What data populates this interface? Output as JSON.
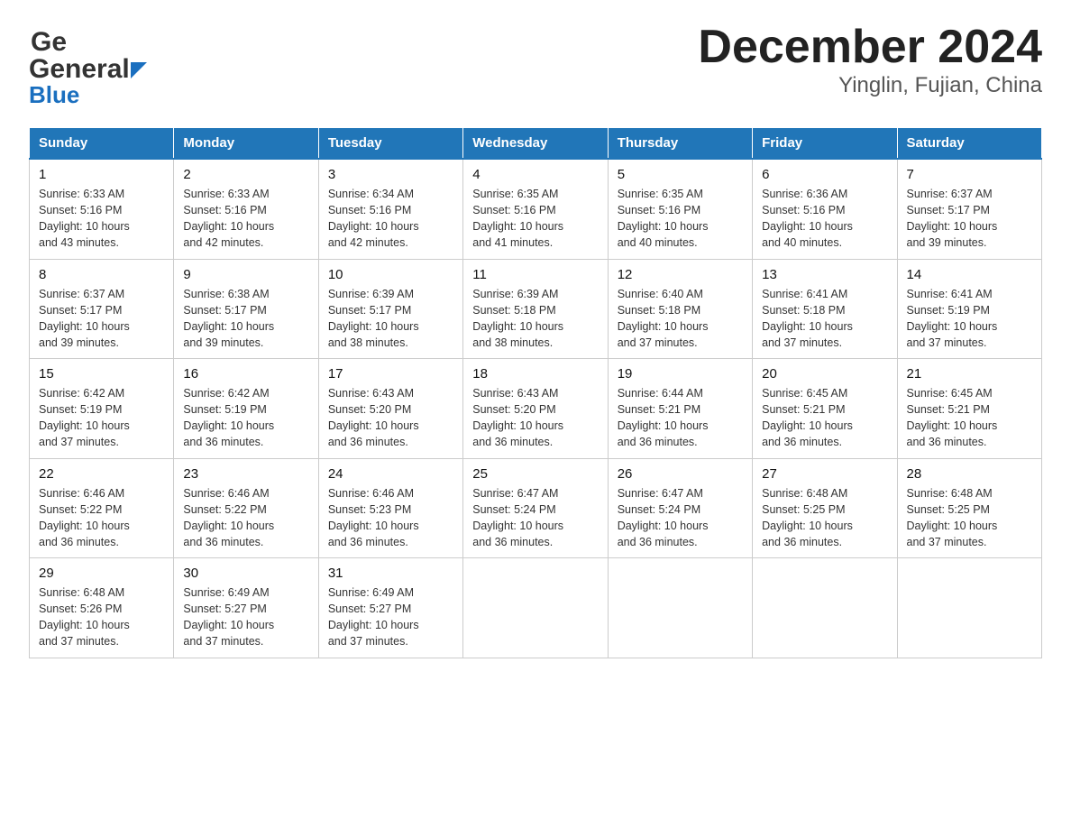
{
  "header": {
    "logo_line1": "General",
    "logo_line2": "Blue",
    "title": "December 2024",
    "subtitle": "Yinglin, Fujian, China"
  },
  "days_of_week": [
    "Sunday",
    "Monday",
    "Tuesday",
    "Wednesday",
    "Thursday",
    "Friday",
    "Saturday"
  ],
  "weeks": [
    [
      {
        "num": "1",
        "sunrise": "6:33 AM",
        "sunset": "5:16 PM",
        "daylight": "10 hours and 43 minutes."
      },
      {
        "num": "2",
        "sunrise": "6:33 AM",
        "sunset": "5:16 PM",
        "daylight": "10 hours and 42 minutes."
      },
      {
        "num": "3",
        "sunrise": "6:34 AM",
        "sunset": "5:16 PM",
        "daylight": "10 hours and 42 minutes."
      },
      {
        "num": "4",
        "sunrise": "6:35 AM",
        "sunset": "5:16 PM",
        "daylight": "10 hours and 41 minutes."
      },
      {
        "num": "5",
        "sunrise": "6:35 AM",
        "sunset": "5:16 PM",
        "daylight": "10 hours and 40 minutes."
      },
      {
        "num": "6",
        "sunrise": "6:36 AM",
        "sunset": "5:16 PM",
        "daylight": "10 hours and 40 minutes."
      },
      {
        "num": "7",
        "sunrise": "6:37 AM",
        "sunset": "5:17 PM",
        "daylight": "10 hours and 39 minutes."
      }
    ],
    [
      {
        "num": "8",
        "sunrise": "6:37 AM",
        "sunset": "5:17 PM",
        "daylight": "10 hours and 39 minutes."
      },
      {
        "num": "9",
        "sunrise": "6:38 AM",
        "sunset": "5:17 PM",
        "daylight": "10 hours and 39 minutes."
      },
      {
        "num": "10",
        "sunrise": "6:39 AM",
        "sunset": "5:17 PM",
        "daylight": "10 hours and 38 minutes."
      },
      {
        "num": "11",
        "sunrise": "6:39 AM",
        "sunset": "5:18 PM",
        "daylight": "10 hours and 38 minutes."
      },
      {
        "num": "12",
        "sunrise": "6:40 AM",
        "sunset": "5:18 PM",
        "daylight": "10 hours and 37 minutes."
      },
      {
        "num": "13",
        "sunrise": "6:41 AM",
        "sunset": "5:18 PM",
        "daylight": "10 hours and 37 minutes."
      },
      {
        "num": "14",
        "sunrise": "6:41 AM",
        "sunset": "5:19 PM",
        "daylight": "10 hours and 37 minutes."
      }
    ],
    [
      {
        "num": "15",
        "sunrise": "6:42 AM",
        "sunset": "5:19 PM",
        "daylight": "10 hours and 37 minutes."
      },
      {
        "num": "16",
        "sunrise": "6:42 AM",
        "sunset": "5:19 PM",
        "daylight": "10 hours and 36 minutes."
      },
      {
        "num": "17",
        "sunrise": "6:43 AM",
        "sunset": "5:20 PM",
        "daylight": "10 hours and 36 minutes."
      },
      {
        "num": "18",
        "sunrise": "6:43 AM",
        "sunset": "5:20 PM",
        "daylight": "10 hours and 36 minutes."
      },
      {
        "num": "19",
        "sunrise": "6:44 AM",
        "sunset": "5:21 PM",
        "daylight": "10 hours and 36 minutes."
      },
      {
        "num": "20",
        "sunrise": "6:45 AM",
        "sunset": "5:21 PM",
        "daylight": "10 hours and 36 minutes."
      },
      {
        "num": "21",
        "sunrise": "6:45 AM",
        "sunset": "5:21 PM",
        "daylight": "10 hours and 36 minutes."
      }
    ],
    [
      {
        "num": "22",
        "sunrise": "6:46 AM",
        "sunset": "5:22 PM",
        "daylight": "10 hours and 36 minutes."
      },
      {
        "num": "23",
        "sunrise": "6:46 AM",
        "sunset": "5:22 PM",
        "daylight": "10 hours and 36 minutes."
      },
      {
        "num": "24",
        "sunrise": "6:46 AM",
        "sunset": "5:23 PM",
        "daylight": "10 hours and 36 minutes."
      },
      {
        "num": "25",
        "sunrise": "6:47 AM",
        "sunset": "5:24 PM",
        "daylight": "10 hours and 36 minutes."
      },
      {
        "num": "26",
        "sunrise": "6:47 AM",
        "sunset": "5:24 PM",
        "daylight": "10 hours and 36 minutes."
      },
      {
        "num": "27",
        "sunrise": "6:48 AM",
        "sunset": "5:25 PM",
        "daylight": "10 hours and 36 minutes."
      },
      {
        "num": "28",
        "sunrise": "6:48 AM",
        "sunset": "5:25 PM",
        "daylight": "10 hours and 37 minutes."
      }
    ],
    [
      {
        "num": "29",
        "sunrise": "6:48 AM",
        "sunset": "5:26 PM",
        "daylight": "10 hours and 37 minutes."
      },
      {
        "num": "30",
        "sunrise": "6:49 AM",
        "sunset": "5:27 PM",
        "daylight": "10 hours and 37 minutes."
      },
      {
        "num": "31",
        "sunrise": "6:49 AM",
        "sunset": "5:27 PM",
        "daylight": "10 hours and 37 minutes."
      },
      null,
      null,
      null,
      null
    ]
  ],
  "labels": {
    "sunrise": "Sunrise:",
    "sunset": "Sunset:",
    "daylight": "Daylight:"
  }
}
